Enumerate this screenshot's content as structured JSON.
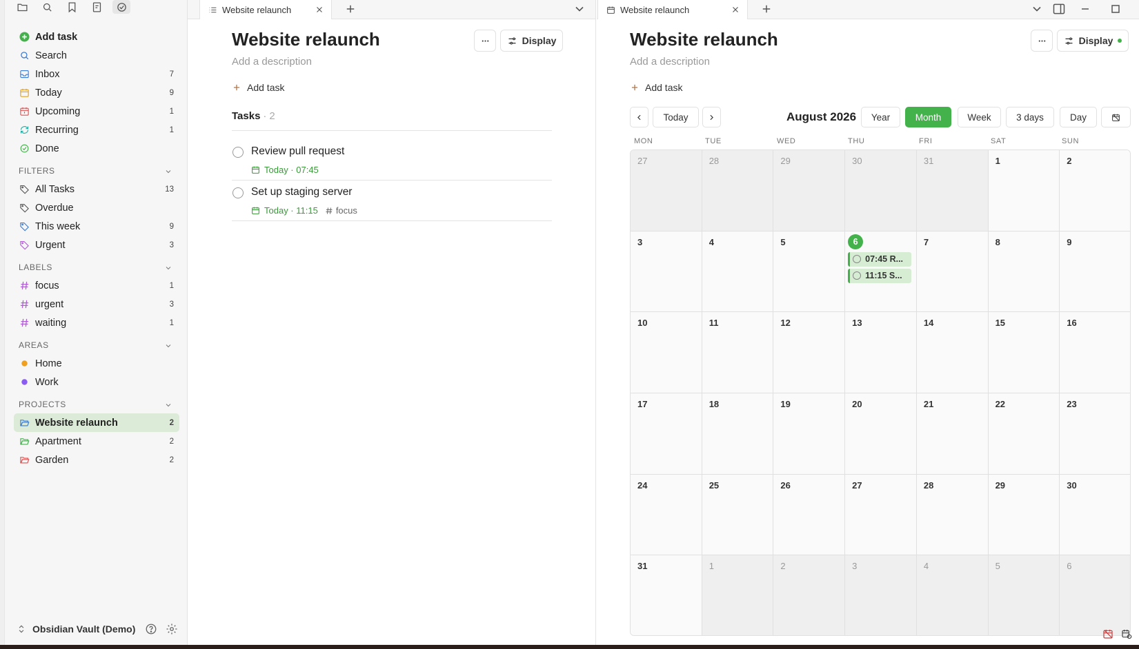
{
  "sidebar": {
    "actions": [
      {
        "label": "Add task"
      },
      {
        "label": "Search"
      },
      {
        "label": "Inbox",
        "count": "7"
      },
      {
        "label": "Today",
        "count": "9"
      },
      {
        "label": "Upcoming",
        "count": "1"
      },
      {
        "label": "Recurring",
        "count": "1"
      },
      {
        "label": "Done"
      }
    ],
    "filters_title": "FILTERS",
    "filters": [
      {
        "label": "All Tasks",
        "count": "13"
      },
      {
        "label": "Overdue"
      },
      {
        "label": "This week",
        "count": "9"
      },
      {
        "label": "Urgent",
        "count": "3"
      }
    ],
    "labels_title": "LABELS",
    "labels": [
      {
        "label": "focus",
        "count": "1"
      },
      {
        "label": "urgent",
        "count": "3"
      },
      {
        "label": "waiting",
        "count": "1"
      }
    ],
    "areas_title": "AREAS",
    "areas": [
      {
        "label": "Home",
        "color": "#f0a020"
      },
      {
        "label": "Work",
        "color": "#8a5cf0"
      }
    ],
    "projects_title": "PROJECTS",
    "projects": [
      {
        "label": "Website relaunch",
        "count": "2"
      },
      {
        "label": "Apartment",
        "count": "2"
      },
      {
        "label": "Garden",
        "count": "2"
      }
    ],
    "vault_name": "Obsidian Vault (Demo)"
  },
  "left_pane": {
    "tab_title": "Website relaunch",
    "title": "Website relaunch",
    "description_placeholder": "Add a description",
    "display_label": "Display",
    "add_task_label": "Add task",
    "tasks_heading": "Tasks",
    "tasks_count": "2",
    "tasks": [
      {
        "name": "Review pull request",
        "date": "Today · 07:45",
        "tag": ""
      },
      {
        "name": "Set up staging server",
        "date": "Today · 11:15",
        "tag": "focus"
      }
    ]
  },
  "right_pane": {
    "tab_title": "Website relaunch",
    "title": "Website relaunch",
    "description_placeholder": "Add a description",
    "display_label": "Display",
    "add_task_label": "Add task",
    "calendar": {
      "today_label": "Today",
      "month_title": "August 2026",
      "views": [
        "Year",
        "Month",
        "Week",
        "3 days",
        "Day"
      ],
      "active_view": "Month",
      "weekdays": [
        "MON",
        "TUE",
        "WED",
        "THU",
        "FRI",
        "SAT",
        "SUN"
      ],
      "weeks": [
        [
          {
            "d": "27",
            "m": 1
          },
          {
            "d": "28",
            "m": 1
          },
          {
            "d": "29",
            "m": 1
          },
          {
            "d": "30",
            "m": 1
          },
          {
            "d": "31",
            "m": 1
          },
          {
            "d": "1",
            "m": 0
          },
          {
            "d": "2",
            "m": 0
          }
        ],
        [
          {
            "d": "3",
            "m": 0
          },
          {
            "d": "4",
            "m": 0
          },
          {
            "d": "5",
            "m": 0
          },
          {
            "d": "6",
            "m": 0,
            "today": 1
          },
          {
            "d": "7",
            "m": 0
          },
          {
            "d": "8",
            "m": 0
          },
          {
            "d": "9",
            "m": 0
          }
        ],
        [
          {
            "d": "10",
            "m": 0
          },
          {
            "d": "11",
            "m": 0
          },
          {
            "d": "12",
            "m": 0
          },
          {
            "d": "13",
            "m": 0
          },
          {
            "d": "14",
            "m": 0
          },
          {
            "d": "15",
            "m": 0
          },
          {
            "d": "16",
            "m": 0
          }
        ],
        [
          {
            "d": "17",
            "m": 0
          },
          {
            "d": "18",
            "m": 0
          },
          {
            "d": "19",
            "m": 0
          },
          {
            "d": "20",
            "m": 0
          },
          {
            "d": "21",
            "m": 0
          },
          {
            "d": "22",
            "m": 0
          },
          {
            "d": "23",
            "m": 0
          }
        ],
        [
          {
            "d": "24",
            "m": 0
          },
          {
            "d": "25",
            "m": 0
          },
          {
            "d": "26",
            "m": 0
          },
          {
            "d": "27",
            "m": 0
          },
          {
            "d": "28",
            "m": 0
          },
          {
            "d": "29",
            "m": 0
          },
          {
            "d": "30",
            "m": 0
          }
        ],
        [
          {
            "d": "31",
            "m": 0
          },
          {
            "d": "1",
            "m": 1
          },
          {
            "d": "2",
            "m": 1
          },
          {
            "d": "3",
            "m": 1
          },
          {
            "d": "4",
            "m": 1
          },
          {
            "d": "5",
            "m": 1
          },
          {
            "d": "6",
            "m": 1
          }
        ]
      ],
      "events": [
        "07:45 R...",
        "11:15 S..."
      ]
    }
  },
  "colors": {
    "accent": "#43b24a",
    "active_project_bg": "#dcebd8"
  }
}
